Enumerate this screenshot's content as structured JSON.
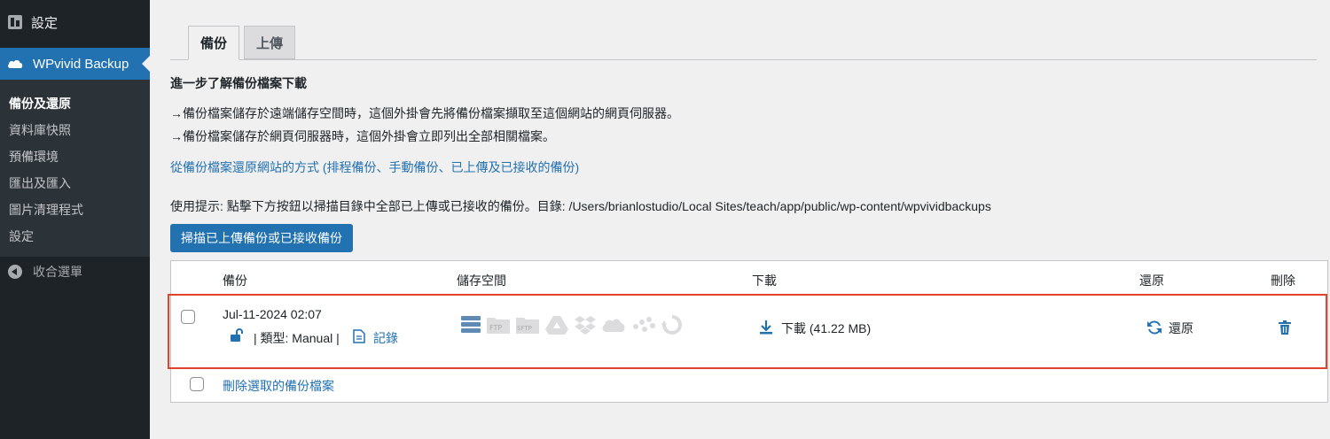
{
  "sidebar": {
    "top_label": "設定",
    "active_label": "WPvivid Backup",
    "items": [
      {
        "label": "備份及還原",
        "current": true
      },
      {
        "label": "資料庫快照",
        "current": false
      },
      {
        "label": "預備環境",
        "current": false
      },
      {
        "label": "匯出及匯入",
        "current": false
      },
      {
        "label": "圖片清理程式",
        "current": false
      },
      {
        "label": "設定",
        "current": false
      }
    ],
    "collapse_label": "收合選單"
  },
  "tabs": [
    {
      "label": "備份",
      "active": true
    },
    {
      "label": "上傳",
      "active": false
    }
  ],
  "content": {
    "heading": "進一步了解備份檔案下載",
    "line1": "→備份檔案儲存於遠端儲存空間時，這個外掛會先將備份檔案擷取至這個網站的網頁伺服器。",
    "line2": "→備份檔案儲存於網頁伺服器時，這個外掛會立即列出全部相關檔案。",
    "restore_link": "從備份檔案還原網站的方式 (排程備份、手動備份、已上傳及已接收的備份)",
    "hint": "使用提示: 點擊下方按鈕以掃描目錄中全部已上傳或已接收的備份。目錄: /Users/brianlostudio/Local Sites/teach/app/public/wp-content/wpvividbackups",
    "scan_button": "掃描已上傳備份或已接收備份"
  },
  "table": {
    "headers": {
      "backup": "備份",
      "storage": "儲存空間",
      "download": "下載",
      "restore": "還原",
      "delete": "刪除"
    },
    "row": {
      "date": "Jul-11-2024 02:07",
      "type_text": "| 類型: Manual |",
      "log_label": "記錄",
      "download_label": "下載 (41.22 MB)",
      "restore_label": "還原"
    },
    "storage_icons": [
      "server-icon",
      "ftp-icon",
      "sftp-icon",
      "google-drive-icon",
      "dropbox-icon",
      "onedrive-icon",
      "s3-icon",
      "wasabi-icon",
      "webdav-icon"
    ],
    "storage_labels": {
      "ftp": "FTP",
      "sftp": "SFTP"
    },
    "delete_selected": "刪除選取的備份檔案"
  },
  "colors": {
    "accent": "#2271b1",
    "sidebar_bg": "#1d2327",
    "submenu_bg": "#2c3338",
    "highlight": "#e1432c"
  }
}
